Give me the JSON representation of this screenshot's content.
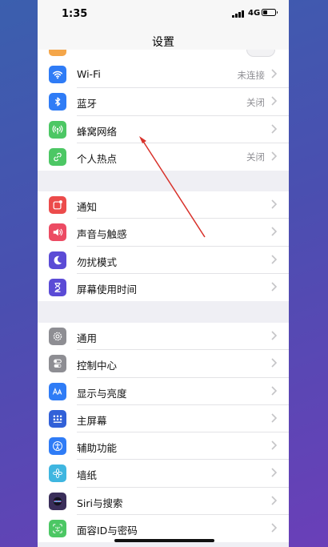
{
  "status": {
    "time": "1:35",
    "network": "4G"
  },
  "nav": {
    "title": "设置"
  },
  "colors": {
    "wifi": "#2f7cf6",
    "bluetooth": "#2f7cf6",
    "cellular": "#4cc764",
    "hotspot": "#4cc764",
    "notifications": "#ec4b4b",
    "sounds": "#ec4b63",
    "dnd": "#5b4bd6",
    "screentime": "#5b4bd6",
    "general": "#8e8e93",
    "control": "#8e8e93",
    "display": "#2f7cf6",
    "home": "#3261d8",
    "accessibility": "#2f7cf6",
    "wallpaper": "#3fb6e0",
    "siri": "#3a2e5a",
    "faceid": "#4cc764",
    "annotation": "#d8312a"
  },
  "group1": [
    {
      "id": "wifi",
      "icon": "wifi-icon",
      "label": "Wi-Fi",
      "value": "未连接"
    },
    {
      "id": "bluetooth",
      "icon": "bluetooth-icon",
      "label": "蓝牙",
      "value": "关闭"
    },
    {
      "id": "cellular",
      "icon": "cellular-icon",
      "label": "蜂窝网络",
      "value": ""
    },
    {
      "id": "hotspot",
      "icon": "hotspot-icon",
      "label": "个人热点",
      "value": "关闭"
    }
  ],
  "group2": [
    {
      "id": "notifications",
      "icon": "notifications-icon",
      "label": "通知"
    },
    {
      "id": "sounds",
      "icon": "speaker-icon",
      "label": "声音与触感"
    },
    {
      "id": "dnd",
      "icon": "moon-icon",
      "label": "勿扰模式"
    },
    {
      "id": "screentime",
      "icon": "hourglass-icon",
      "label": "屏幕使用时间"
    }
  ],
  "group3": [
    {
      "id": "general",
      "icon": "gear-icon",
      "label": "通用"
    },
    {
      "id": "control",
      "icon": "toggles-icon",
      "label": "控制中心"
    },
    {
      "id": "display",
      "icon": "text-size-icon",
      "label": "显示与亮度"
    },
    {
      "id": "home",
      "icon": "home-screen-icon",
      "label": "主屏幕"
    },
    {
      "id": "accessibility",
      "icon": "accessibility-icon",
      "label": "辅助功能"
    },
    {
      "id": "wallpaper",
      "icon": "flower-icon",
      "label": "墙纸"
    },
    {
      "id": "siri",
      "icon": "siri-icon",
      "label": "Siri与搜索"
    },
    {
      "id": "faceid",
      "icon": "face-id-icon",
      "label": "面容ID与密码"
    }
  ]
}
